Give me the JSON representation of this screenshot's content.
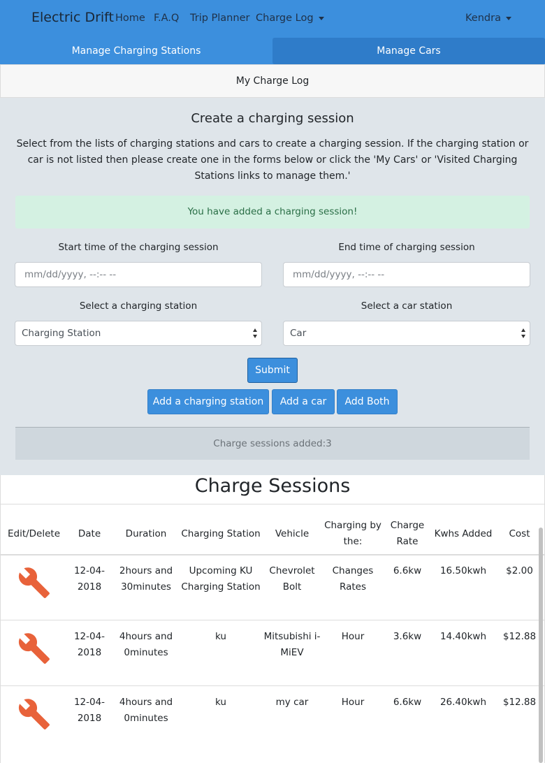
{
  "nav": {
    "brand": "Electric Drift",
    "links": [
      "Home",
      "F.A.Q",
      "Trip Planner",
      "Charge Log"
    ],
    "user": "Kendra"
  },
  "subnav": {
    "manage_stations": "Manage Charging Stations",
    "manage_cars": "Manage Cars"
  },
  "log_title": "My Charge Log",
  "form": {
    "heading": "Create a charging session",
    "description": "Select from the lists of charging stations and cars to create a charging session. If the charging station or car is not listed then please create one in the forms below or click the 'My Cars' or 'Visited Charging Stations links to manage them.'",
    "alert": "You have added a charging session!",
    "start_label": "Start time of the charging session",
    "start_placeholder": "mm/dd/yyyy, --:-- --",
    "end_label": "End time of charging session",
    "end_placeholder": "mm/dd/yyyy, --:-- --",
    "station_label": "Select a charging station",
    "station_value": "Charging Station",
    "car_label": "Select a car station",
    "car_value": "Car",
    "submit": "Submit",
    "add_station": "Add a charging station",
    "add_car": "Add a car",
    "add_both": "Add Both",
    "counter": "Charge sessions added:3"
  },
  "sessions": {
    "title": "Charge Sessions",
    "columns": [
      "Edit/Delete",
      "Date",
      "Duration",
      "Charging Station",
      "Vehicle",
      "Charging by the:",
      "Charge Rate",
      "Kwhs Added",
      "Cost"
    ],
    "rows": [
      {
        "date": "12-04-2018",
        "duration": "2hours and 30minutes",
        "station": "Upcoming KU Charging Station",
        "vehicle": "Chevrolet Bolt",
        "charging_by": "Changes Rates",
        "rate": "6.6kw",
        "kwhs": "16.50kwh",
        "cost": "$2.00"
      },
      {
        "date": "12-04-2018",
        "duration": "4hours and 0minutes",
        "station": "ku",
        "vehicle": "Mitsubishi i-MiEV",
        "charging_by": "Hour",
        "rate": "3.6kw",
        "kwhs": "14.40kwh",
        "cost": "$12.88"
      },
      {
        "date": "12-04-2018",
        "duration": "4hours and 0minutes",
        "station": "ku",
        "vehicle": "my car",
        "charging_by": "Hour",
        "rate": "6.6kw",
        "kwhs": "26.40kwh",
        "cost": "$12.88"
      }
    ]
  },
  "icons": {
    "edit": "wrench-icon",
    "dropdown": "caret-down-icon"
  },
  "colors": {
    "primary": "#3c8fdd",
    "success_bg": "#d4f1e2",
    "wrench": "#e8623a"
  }
}
